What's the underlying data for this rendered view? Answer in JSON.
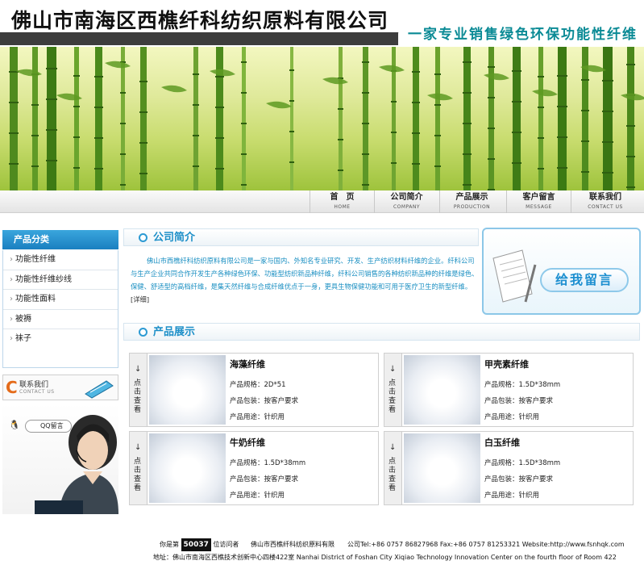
{
  "header": {
    "company_name": "佛山市南海区西樵纤科纺织原料有限公司",
    "slogan": "一家专业销售绿色环保功能性纤维"
  },
  "nav": [
    {
      "zh": "首　页",
      "en": "HOME"
    },
    {
      "zh": "公司简介",
      "en": "COMPANY"
    },
    {
      "zh": "产品展示",
      "en": "PRODUCTION"
    },
    {
      "zh": "客户留言",
      "en": "MESSAGE"
    },
    {
      "zh": "联系我们",
      "en": "CONTACT US"
    }
  ],
  "sidebar": {
    "title": "产品分类",
    "items": [
      "功能性纤维",
      "功能性纤维纱线",
      "功能性面料",
      "被褥",
      "袜子"
    ],
    "contact_zh": "联系我们",
    "contact_en": "CONTACT US",
    "qq_label": "QQ留言"
  },
  "about": {
    "title": "公司简介",
    "text": "佛山市西樵纤科纺织原料有限公司是一家与国内、外知名专业研究、开发、生产纺织材料纤维的企业。纤科公司与生产企业共同合作开发生产各种绿色环保、功能型纺织新品种纤维，纤科公司销售的各种纺织新品种的纤维是绿色、保健、舒适型的高档纤维，是集天然纤维与合成纤维优点于一身，更具生物保健功能和可用于医疗卫生的新型纤维。",
    "more": "[详细]"
  },
  "products": {
    "title": "产品展示",
    "side_text": "点击查看",
    "items": [
      {
        "name": "海藻纤维",
        "spec": "产品规格：2D*51",
        "pack": "产品包装：按客户要求",
        "use": "产品用途：针织用"
      },
      {
        "name": "甲壳素纤维",
        "spec": "产品规格：1.5D*38mm",
        "pack": "产品包装：按客户要求",
        "use": "产品用途：针织用"
      },
      {
        "name": "牛奶纤维",
        "spec": "产品规格：1.5D*38mm",
        "pack": "产品包装：按客户要求",
        "use": "产品用途：针织用"
      },
      {
        "name": "白玉纤维",
        "spec": "产品规格：1.5D*38mm",
        "pack": "产品包装：按客户要求",
        "use": "产品用途：针织用"
      }
    ]
  },
  "message_widget": {
    "button": "给我留言"
  },
  "footer": {
    "visitor_prefix": "你是第",
    "visitor_count": "50037",
    "visitor_suffix": "位访问者",
    "line1_rest": "佛山市西樵纤科纺织原料有限　　公司Tel:+86 0757 86827968 Fax:+86 0757 81253321 Website:http://www.fsnhqk.com",
    "line2": "地址：佛山市南海区西樵技术创新中心四楼422室  Nanhai District of Foshan City Xiqiao Technology Innovation Center on the fourth floor of Room 422"
  }
}
